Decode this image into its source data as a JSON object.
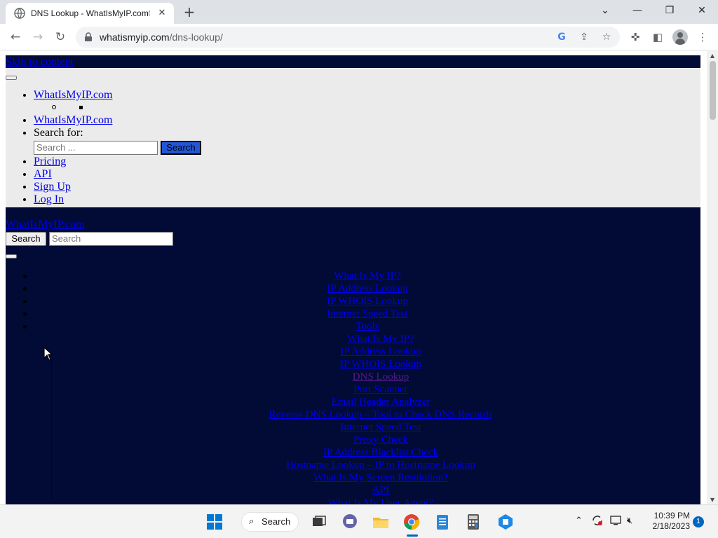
{
  "browser": {
    "tab_title": "DNS Lookup - WhatIsMyIP.com®",
    "tab_close": "✕",
    "new_tab": "+",
    "url_host": "whatismyip.com",
    "url_path": "/dns-lookup/",
    "window_controls": {
      "collapse": "⌄",
      "minimize": "—",
      "restore": "❐",
      "close": "✕"
    }
  },
  "page": {
    "skip_link": "Skip to content",
    "menu": {
      "logo_alt": "WhatIsMyIP.com",
      "site_link": "WhatIsMyIP.com",
      "search_label": "Search for:",
      "search_placeholder": "Search ...",
      "search_button": "Search",
      "items": [
        "Pricing",
        "API",
        "Sign Up",
        "Log In"
      ]
    },
    "header": {
      "logo_alt": "WhatIsMyIP.com",
      "search_button": "Search",
      "search_placeholder": "Search"
    },
    "nav": {
      "top_items": [
        "What Is My IP?",
        "IP Address Lookup",
        "IP WHOIS Lookup",
        "Internet Speed Test",
        "Tools"
      ],
      "tool_items": [
        "What Is My IP?",
        "IP Address Lookup",
        "IP WHOIS Lookup",
        "DNS Lookup",
        "Port Scanner",
        "Email Header Analyzer",
        "Reverse DNS Lookup – Tool to Check DNS Records",
        "Internet Speed Test",
        "Proxy Check",
        "IP Address Blacklist Check",
        "Hostname Lookup – IP to Hostname Lookup",
        "What Is My Screen Resolution?",
        "API",
        "What Is My User Agent?"
      ],
      "current_item": "DNS Lookup"
    }
  },
  "taskbar": {
    "search_label": "Search",
    "time": "10:39 PM",
    "date": "2/18/2023",
    "notification_count": "1"
  },
  "colors": {
    "page_dark_bg": "#010b35",
    "menu_bg": "#ebebeb",
    "link": "#0000ee",
    "visited_link": "#551a8b",
    "search_button_bg": "#2356d4",
    "windows_accent": "#0067c0"
  }
}
